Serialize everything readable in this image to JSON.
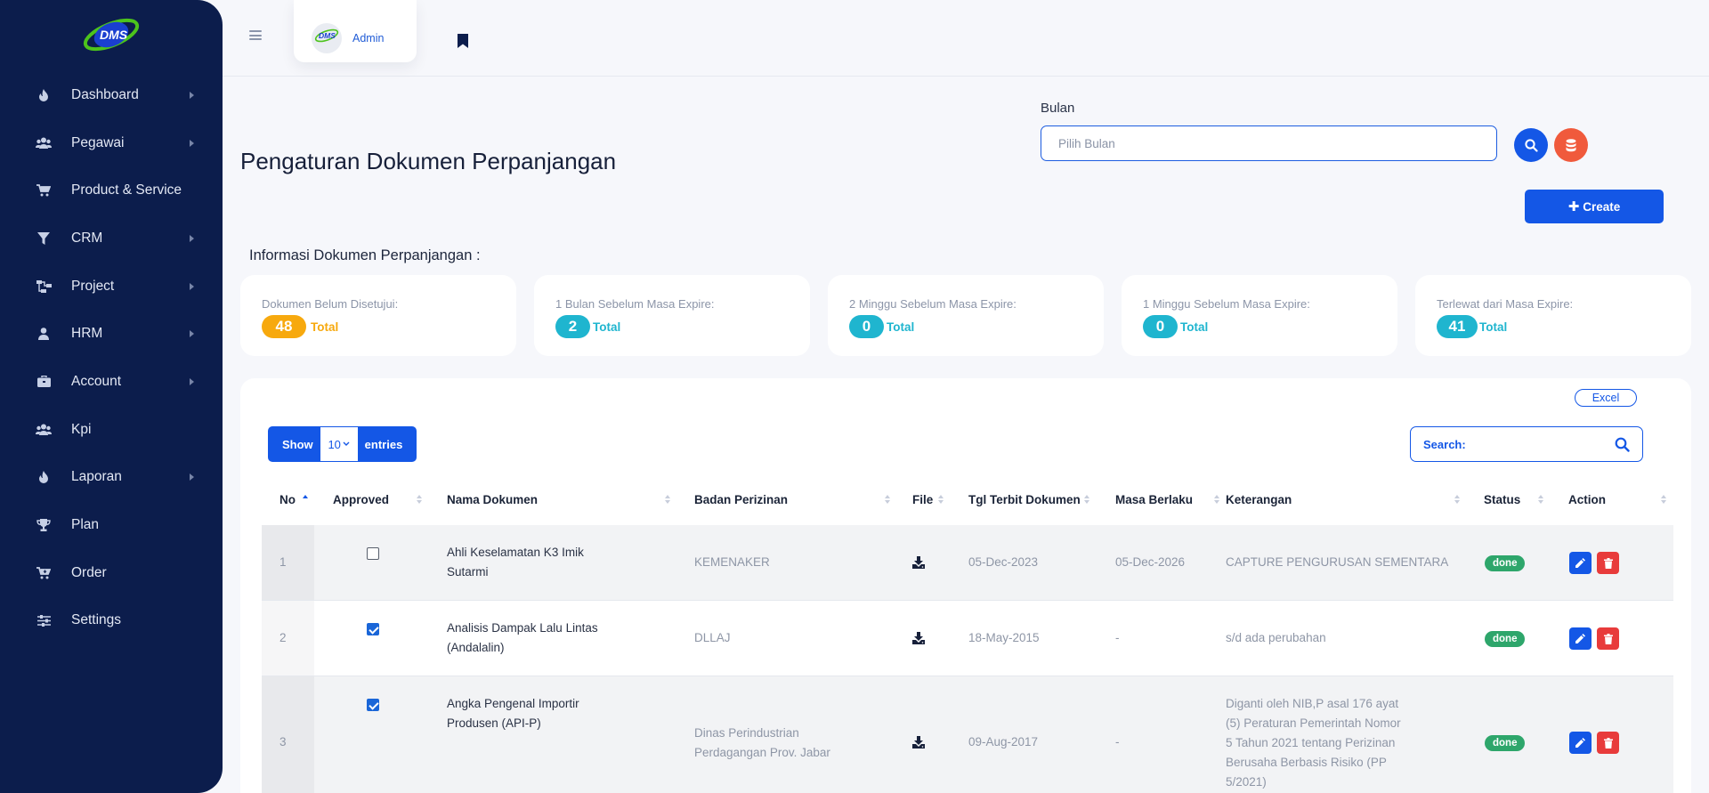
{
  "app": {
    "logo_text": "DMS"
  },
  "sidebar": {
    "items": [
      {
        "label": "Dashboard",
        "icon": "fire-icon",
        "has_submenu": true
      },
      {
        "label": "Pegawai",
        "icon": "users-icon",
        "has_submenu": true
      },
      {
        "label": "Product & Service",
        "icon": "cart-icon",
        "has_submenu": false
      },
      {
        "label": "CRM",
        "icon": "filter-icon",
        "has_submenu": true
      },
      {
        "label": "Project",
        "icon": "project-diagram-icon",
        "has_submenu": true
      },
      {
        "label": "HRM",
        "icon": "user-icon",
        "has_submenu": true
      },
      {
        "label": "Account",
        "icon": "briefcase-icon",
        "has_submenu": true
      },
      {
        "label": "Kpi",
        "icon": "users-icon",
        "has_submenu": false
      },
      {
        "label": "Laporan",
        "icon": "fire-icon",
        "has_submenu": true
      },
      {
        "label": "Plan",
        "icon": "trophy-icon",
        "has_submenu": false
      },
      {
        "label": "Order",
        "icon": "cart-plus-icon",
        "has_submenu": false
      },
      {
        "label": "Settings",
        "icon": "sliders-icon",
        "has_submenu": false
      }
    ]
  },
  "topbar": {
    "user_name": "Admin"
  },
  "page": {
    "title": "Pengaturan Dokumen Perpanjangan",
    "filter_label": "Bulan",
    "filter_placeholder": "Pilih Bulan",
    "create_label": "Create",
    "info_title": "Informasi Dokumen Perpanjangan :"
  },
  "cards": [
    {
      "label": "Dokumen Belum Disetujui:",
      "count": "48",
      "total_label": "Total",
      "color": "#f7a90e"
    },
    {
      "label": "1 Bulan Sebelum Masa Expire:",
      "count": "2",
      "total_label": "Total",
      "color": "#1fb5cf"
    },
    {
      "label": "2 Minggu Sebelum Masa Expire:",
      "count": "0",
      "total_label": "Total",
      "color": "#1fb5cf"
    },
    {
      "label": "1 Minggu Sebelum Masa Expire:",
      "count": "0",
      "total_label": "Total",
      "color": "#1fb5cf"
    },
    {
      "label": "Terlewat dari Masa Expire:",
      "count": "41",
      "total_label": "Total",
      "color": "#1fb5cf"
    }
  ],
  "table": {
    "excel_label": "Excel",
    "length": {
      "prefix": "Show",
      "value": "10",
      "suffix": "entries"
    },
    "search_label": "Search:",
    "columns": [
      "No",
      "Approved",
      "Nama Dokumen",
      "Badan Perizinan",
      "File",
      "Tgl Terbit Dokumen",
      "Masa Berlaku",
      "Keterangan",
      "Status",
      "Action"
    ],
    "rows": [
      {
        "no": "1",
        "approved": false,
        "nama": "Ahli Keselamatan K3 Imik Sutarmi",
        "badan": "KEMENAKER",
        "tgl": "05-Dec-2023",
        "masa": "05-Dec-2026",
        "keterangan": "CAPTURE PENGURUSAN SEMENTARA",
        "status": "done"
      },
      {
        "no": "2",
        "approved": true,
        "nama": "Analisis Dampak Lalu Lintas (Andalalin)",
        "badan": "DLLAJ",
        "tgl": "18-May-2015",
        "masa": "-",
        "keterangan": "s/d ada perubahan",
        "status": "done"
      },
      {
        "no": "3",
        "approved": true,
        "nama": "Angka Pengenal Importir Produsen (API-P)",
        "badan": "Dinas Perindustrian Perdagangan Prov. Jabar",
        "tgl": "09-Aug-2017",
        "masa": "-",
        "keterangan": "Diganti oleh NIB,P asal 176 ayat (5) Peraturan Pemerintah Nomor 5 Tahun 2021 tentang Perizinan Berusaha Berbasis Risiko (PP 5/2021)",
        "status": "done"
      }
    ]
  },
  "colors": {
    "sidebar_bg": "#0c1d4c",
    "primary": "#1457e6",
    "danger": "#e83b3b",
    "orange": "#f05a3c",
    "success": "#2ea66b"
  }
}
